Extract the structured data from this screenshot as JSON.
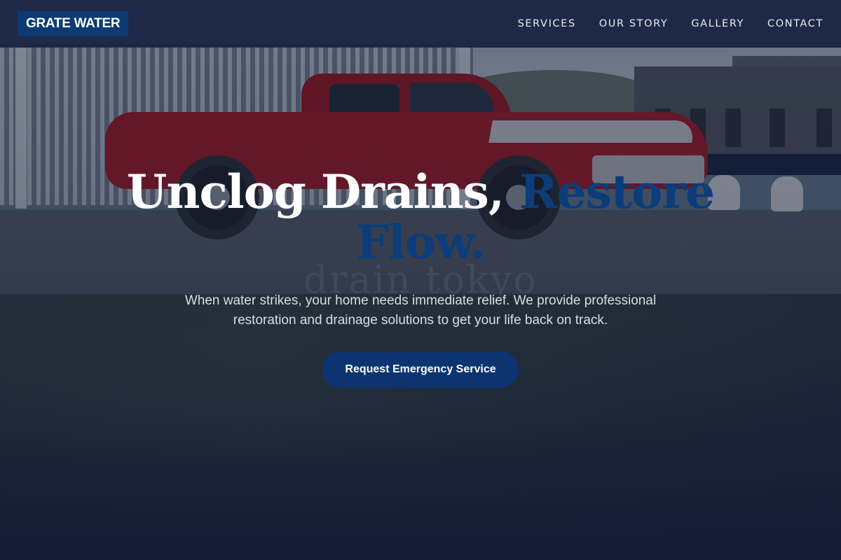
{
  "brand": {
    "name": "GRATE WATER"
  },
  "nav": {
    "items": [
      {
        "label": "SERVICES"
      },
      {
        "label": "OUR STORY"
      },
      {
        "label": "GALLERY"
      },
      {
        "label": "CONTACT"
      }
    ]
  },
  "hero": {
    "headline_main": "Unclog Drains, ",
    "headline_accent": "Restore Flow.",
    "subtext": "When water strikes, your home needs immediate relief. We provide professional restoration and drainage solutions to get your life back on track.",
    "cta_label": "Request Emergency Service",
    "background_watermark": "drain tokyo"
  },
  "colors": {
    "header_bg": "#1a2544",
    "brand_bg": "#0c3a72",
    "accent": "#0c3d7a",
    "cta_bg": "#0c3470",
    "text_light": "#ffffff"
  }
}
